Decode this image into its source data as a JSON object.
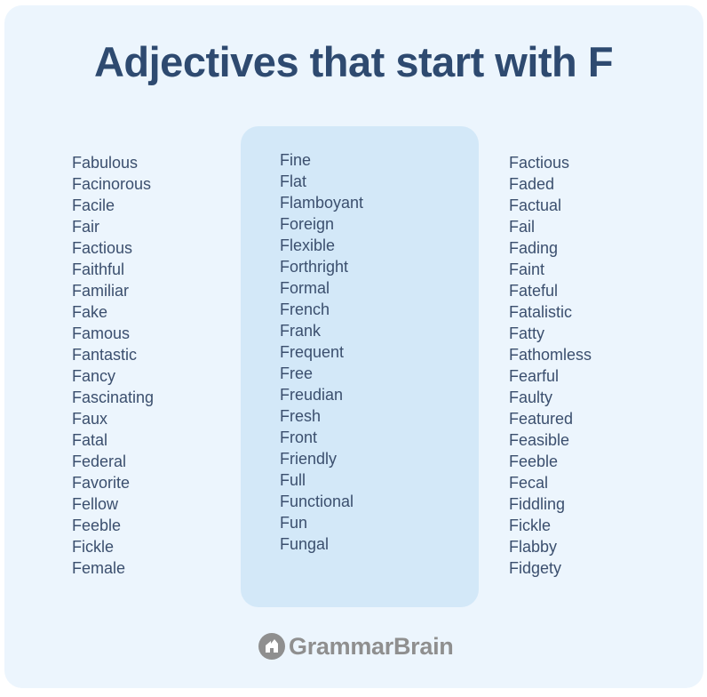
{
  "title": "Adjectives that start with F",
  "colors": {
    "background": "#ecf5fd",
    "highlight_panel": "#d3e8f8",
    "title_text": "#2e4a70",
    "word_text": "#3b4f6e",
    "logo": "#8f8f8f"
  },
  "columns": {
    "left": [
      "Fabulous",
      "Facinorous",
      "Facile",
      "Fair",
      "Factious",
      "Faithful",
      "Familiar",
      "Fake",
      "Famous",
      "Fantastic",
      "Fancy",
      "Fascinating",
      "Faux",
      "Fatal",
      "Federal",
      "Favorite",
      "Fellow",
      "Feeble",
      "Fickle",
      "Female"
    ],
    "middle": [
      "Fine",
      "Flat",
      "Flamboyant",
      "Foreign",
      "Flexible",
      "Forthright",
      "Formal",
      "French",
      "Frank",
      "Frequent",
      "Free",
      "Freudian",
      "Fresh",
      "Front",
      "Friendly",
      "Full",
      "Functional",
      "Fun",
      "Fungal"
    ],
    "right": [
      "Factious",
      "Faded",
      "Factual",
      "Fail",
      "Fading",
      "Faint",
      "Fateful",
      "Fatalistic",
      "Fatty",
      "Fathomless",
      "Fearful",
      "Faulty",
      "Featured",
      "Feasible",
      "Feeble",
      "Fecal",
      "Fiddling",
      "Fickle",
      "Flabby",
      "Fidgety"
    ]
  },
  "logo": {
    "icon": "grammarbrain-house-icon",
    "text": "GrammarBrain"
  }
}
